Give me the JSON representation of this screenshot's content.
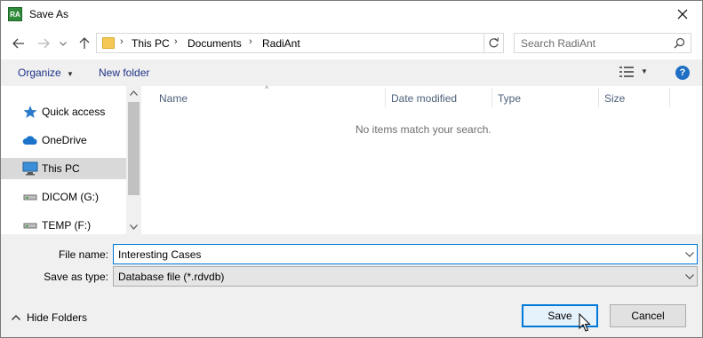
{
  "window": {
    "title": "Save As",
    "app_icon_text": "RA"
  },
  "address": {
    "crumbs": [
      "This PC",
      "Documents",
      "RadiAnt"
    ]
  },
  "search": {
    "placeholder": "Search RadiAnt"
  },
  "toolbar": {
    "organize_label": "Organize",
    "new_folder_label": "New folder",
    "help_label": "?"
  },
  "nav": {
    "items": [
      {
        "label": "Quick access",
        "icon": "star-icon"
      },
      {
        "label": "OneDrive",
        "icon": "cloud-icon"
      },
      {
        "label": "This PC",
        "icon": "computer-icon",
        "selected": true
      },
      {
        "label": "DICOM (G:)",
        "icon": "drive-icon"
      },
      {
        "label": "TEMP (F:)",
        "icon": "drive-icon"
      }
    ]
  },
  "list": {
    "columns": [
      "Name",
      "Date modified",
      "Type",
      "Size"
    ],
    "empty_message": "No items match your search."
  },
  "form": {
    "filename_label": "File name:",
    "filename_value": "Interesting Cases",
    "savetype_label": "Save as type:",
    "savetype_value": "Database file (*.rdvdb)"
  },
  "footer": {
    "hide_folders_label": "Hide Folders",
    "save_label": "Save",
    "cancel_label": "Cancel"
  },
  "colors": {
    "accent": "#0078d7",
    "link": "#1e3287",
    "panel": "#f0f0f0"
  }
}
